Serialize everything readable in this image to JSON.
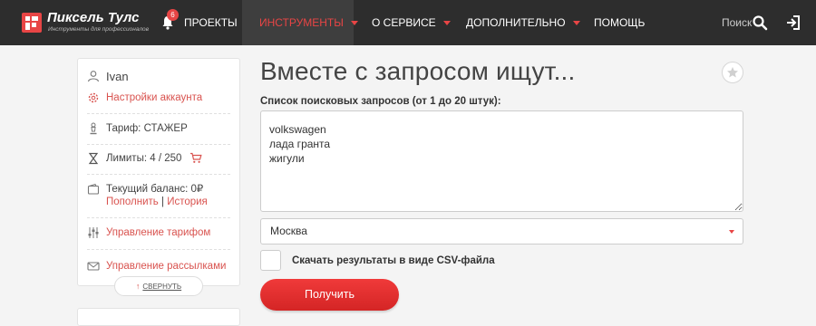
{
  "brand": {
    "title": "Пиксель Тулс",
    "subtitle": "Инструменты для профессионалов",
    "accent": "#e84545"
  },
  "nav": {
    "notifications_count": "6",
    "items": [
      {
        "label": "ПРОЕКТЫ"
      },
      {
        "label": "ИНСТРУМЕНТЫ"
      },
      {
        "label": "О СЕРВИСЕ"
      },
      {
        "label": "ДОПОЛНИТЕЛЬНО"
      },
      {
        "label": "ПОМОЩЬ"
      }
    ],
    "search_label": "Поиск"
  },
  "sidebar": {
    "username": "Ivan",
    "account_settings": "Настройки аккаунта",
    "tariff": "Тариф: СТАЖЕР",
    "limits": "Лимиты: 4 / 250",
    "balance": "Текущий баланс: 0₽",
    "topup": "Пополнить",
    "divider": "|",
    "history": "История",
    "manage_tariff": "Управление тарифом",
    "manage_mailings": "Управление рассылками",
    "collapse": "СВЕРНУТЬ"
  },
  "main": {
    "title": "Вместе с запросом ищут...",
    "queries_label": "Список поисковых запросов (от 1 до 20 штук):",
    "queries_value": "volkswagen\nлада гранта\nжигули",
    "region": "Москва",
    "csv_label": "Скачать результаты в виде CSV-файла",
    "submit": "Получить"
  }
}
